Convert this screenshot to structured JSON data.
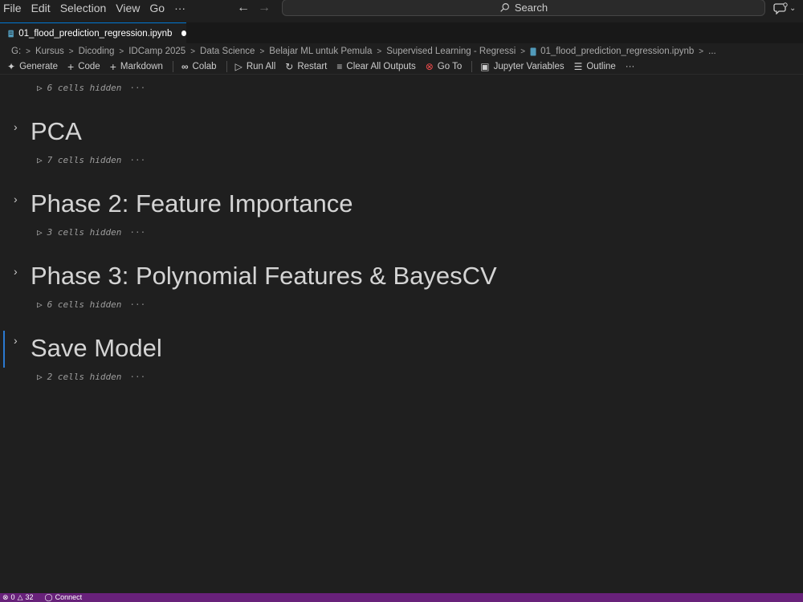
{
  "menu": [
    "File",
    "Edit",
    "Selection",
    "View",
    "Go",
    "···"
  ],
  "search": {
    "label": "Search"
  },
  "tab": {
    "label": "01_flood_prediction_regression.ipynb"
  },
  "breadcrumb": [
    "G:",
    "Kursus",
    "Dicoding",
    "IDCamp 2025",
    "Data Science",
    "Belajar ML untuk Pemula",
    "Supervised Learning - Regressi",
    "01_flood_prediction_regression.ipynb",
    "..."
  ],
  "toolbar": {
    "generate": "Generate",
    "code": "Code",
    "markdown": "Markdown",
    "colab": "Colab",
    "run_all": "Run All",
    "restart": "Restart",
    "clear_outputs": "Clear All Outputs",
    "go_to": "Go To",
    "jupyter_variables": "Jupyter Variables",
    "outline": "Outline",
    "more": "···"
  },
  "notebook": {
    "top_hidden": "6 cells hidden",
    "sections": [
      {
        "title": "PCA",
        "hidden": "7 cells hidden"
      },
      {
        "title": "Phase 2: Feature Importance",
        "hidden": "3 cells hidden"
      },
      {
        "title": "Phase 3: Polynomial Features & BayesCV",
        "hidden": "6 cells hidden"
      },
      {
        "title": "Save Model",
        "hidden": "2 cells hidden"
      }
    ],
    "ellipsis": "···"
  },
  "status": {
    "errors": "0",
    "warnings": "32",
    "connect": "Connect"
  },
  "colors": {
    "accent": "#0078d4",
    "statusbar": "#68217a",
    "focus": "#2b79d0"
  }
}
